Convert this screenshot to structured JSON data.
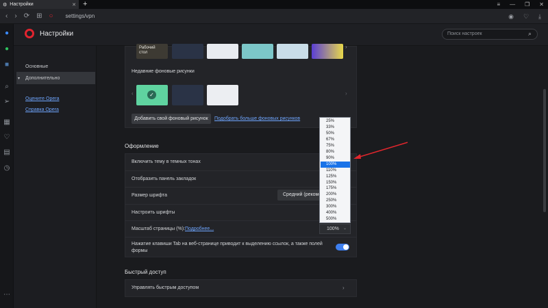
{
  "tab": {
    "title": "Настройки",
    "close": "✕"
  },
  "address": {
    "url": "settings/vpn"
  },
  "window": {
    "menu": "≡",
    "minimize": "—",
    "restore": "❐",
    "close": "✕"
  },
  "header": {
    "title": "Настройки",
    "search_placeholder": "Поиск настроек"
  },
  "sidebar": {
    "items": [
      {
        "label": "Основные"
      },
      {
        "label": "Дополнительно"
      }
    ],
    "links": [
      {
        "label": "Оцените Opera"
      },
      {
        "label": "Справка Opera"
      }
    ]
  },
  "wallpapers": {
    "top_thumb_label": "Рабочий стол",
    "recent_title": "Недавние фоновые рисунки",
    "add_button": "Добавить свой фоновый рисунок",
    "more_link": "Подобрать больше фоновых рисунков"
  },
  "appearance": {
    "section_title": "Оформление",
    "dark_theme": "Включить тему в темных тонах",
    "bookmarks_bar": "Отобразить панель закладок",
    "font_size": "Размер шрифта",
    "font_size_value": "Средний (рекомендуется)",
    "customize_fonts": "Настроить шрифты",
    "page_zoom": "Масштаб страницы (%):",
    "page_zoom_link": "Подробнее...",
    "page_zoom_value": "100%",
    "tab_key": "Нажатие клавиши Tab на веб-странице приводит к выделению ссылок, а также полей формы",
    "tab_key_on": true
  },
  "zoom_options": [
    "25%",
    "33%",
    "50%",
    "67%",
    "75%",
    "80%",
    "90%",
    "100%",
    "110%",
    "125%",
    "150%",
    "175%",
    "200%",
    "250%",
    "300%",
    "400%",
    "500%"
  ],
  "zoom_selected_index": 7,
  "speed_dial": {
    "section_title": "Быстрый доступ",
    "manage": "Управлять быстрым доступом"
  },
  "colors": {
    "accent": "#1a73e8",
    "brand": "#e1242f",
    "annotation_arrow": "#e0262d"
  }
}
